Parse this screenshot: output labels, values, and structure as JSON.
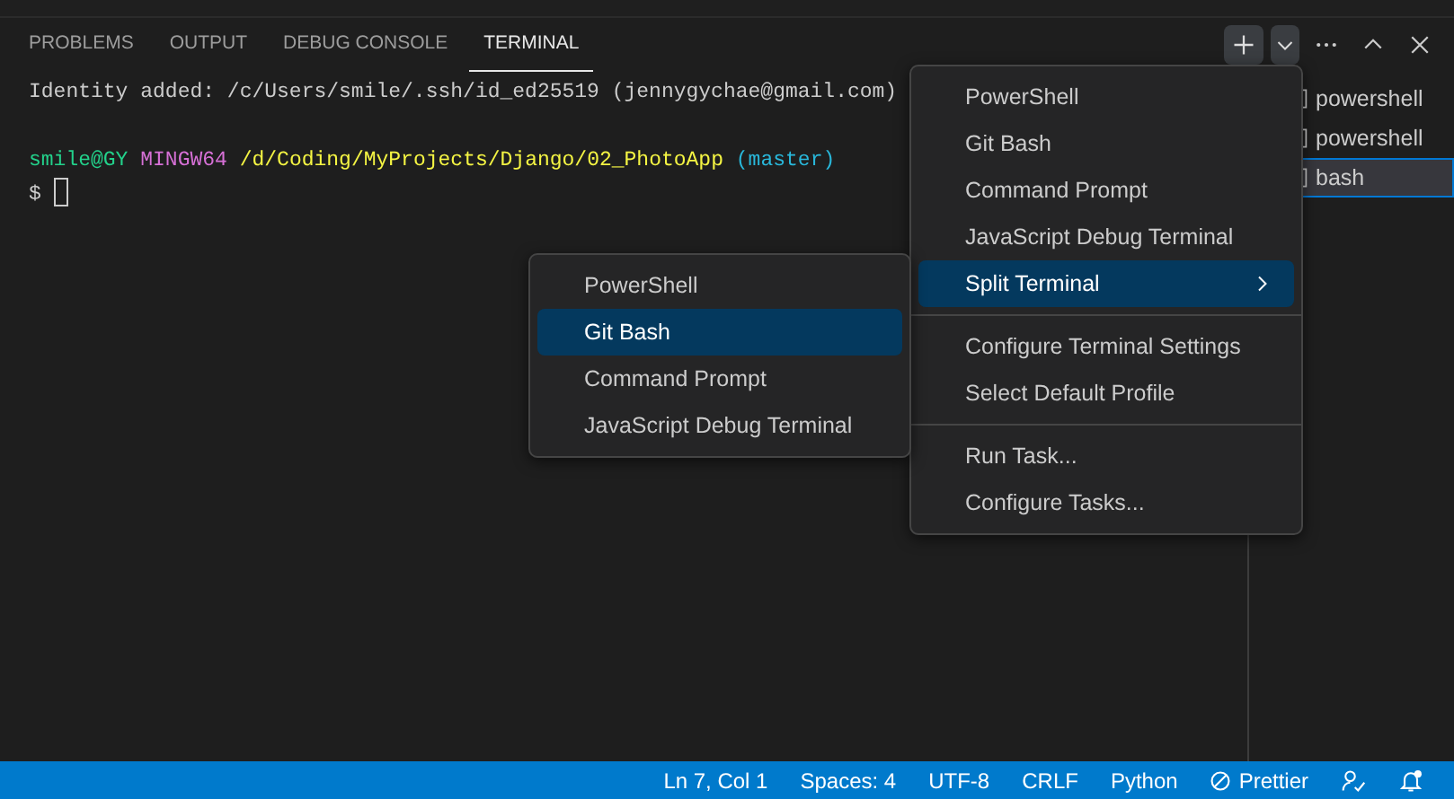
{
  "panel_tabs": [
    {
      "label": "PROBLEMS",
      "selected": false
    },
    {
      "label": "OUTPUT",
      "selected": false
    },
    {
      "label": "DEBUG CONSOLE",
      "selected": false
    },
    {
      "label": "TERMINAL",
      "selected": true
    }
  ],
  "terminal_lines": [
    {
      "gap_before": false,
      "segments": [
        {
          "text": "Identity added: /c/Users/smile/.ssh/id_ed25519 (jennygychae@gmail.com)",
          "color": "#cccccc"
        }
      ]
    },
    {
      "gap_before": true,
      "segments": [
        {
          "text": "smile@GY ",
          "color": "#23d18b"
        },
        {
          "text": "MINGW64 ",
          "color": "#d670d6"
        },
        {
          "text": "/d/Coding/MyProjects/Django/02_PhotoApp ",
          "color": "#f5f543"
        },
        {
          "text": "(master)",
          "color": "#29b8db"
        }
      ]
    },
    {
      "gap_before": false,
      "segments": [
        {
          "text": "$ ",
          "color": "#cccccc"
        },
        {
          "kind": "cursor"
        }
      ]
    }
  ],
  "terminal_list": [
    {
      "label": "powershell",
      "selected": false
    },
    {
      "label": "powershell",
      "selected": false
    },
    {
      "label": "bash",
      "selected": true
    }
  ],
  "new_terminal_menu": [
    {
      "kind": "item",
      "label": "PowerShell",
      "selected": false
    },
    {
      "kind": "item",
      "label": "Git Bash",
      "selected": false
    },
    {
      "kind": "item",
      "label": "Command Prompt",
      "selected": false
    },
    {
      "kind": "item",
      "label": "JavaScript Debug Terminal",
      "selected": false
    },
    {
      "kind": "submenu",
      "label": "Split Terminal",
      "selected": true
    },
    {
      "kind": "separator"
    },
    {
      "kind": "item",
      "label": "Configure Terminal Settings",
      "selected": false
    },
    {
      "kind": "item",
      "label": "Select Default Profile",
      "selected": false
    },
    {
      "kind": "separator"
    },
    {
      "kind": "item",
      "label": "Run Task...",
      "selected": false
    },
    {
      "kind": "item",
      "label": "Configure Tasks...",
      "selected": false
    }
  ],
  "split_submenu": [
    {
      "label": "PowerShell",
      "selected": false
    },
    {
      "label": "Git Bash",
      "selected": true
    },
    {
      "label": "Command Prompt",
      "selected": false
    },
    {
      "label": "JavaScript Debug Terminal",
      "selected": false
    }
  ],
  "status_bar": [
    {
      "kind": "text",
      "label": "Ln 7, Col 1"
    },
    {
      "kind": "text",
      "label": "Spaces: 4"
    },
    {
      "kind": "text",
      "label": "UTF-8"
    },
    {
      "kind": "text",
      "label": "CRLF"
    },
    {
      "kind": "text",
      "label": "Python"
    },
    {
      "kind": "prettier",
      "label": "Prettier"
    },
    {
      "kind": "feedback"
    },
    {
      "kind": "bell"
    }
  ]
}
